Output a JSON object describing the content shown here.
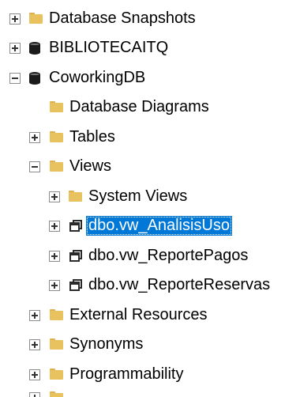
{
  "object_explorer": {
    "nodes": [
      {
        "label": "Database Snapshots",
        "icon": "folder-icon",
        "expander": "plus"
      },
      {
        "label": "BIBLIOTECAITQ",
        "icon": "database-icon",
        "expander": "plus"
      },
      {
        "label": "CoworkingDB",
        "icon": "database-icon",
        "expander": "minus"
      },
      {
        "label": "Database Diagrams",
        "icon": "folder-icon",
        "expander": "none"
      },
      {
        "label": "Tables",
        "icon": "folder-icon",
        "expander": "plus"
      },
      {
        "label": "Views",
        "icon": "folder-icon",
        "expander": "minus"
      },
      {
        "label": "System Views",
        "icon": "folder-icon",
        "expander": "plus"
      },
      {
        "label": "dbo.vw_AnalisisUso",
        "icon": "view-icon",
        "expander": "plus",
        "selected": true
      },
      {
        "label": "dbo.vw_ReportePagos",
        "icon": "view-icon",
        "expander": "plus"
      },
      {
        "label": "dbo.vw_ReporteReservas",
        "icon": "view-icon",
        "expander": "plus"
      },
      {
        "label": "External Resources",
        "icon": "folder-icon",
        "expander": "plus"
      },
      {
        "label": "Synonyms",
        "icon": "folder-icon",
        "expander": "plus"
      },
      {
        "label": "Programmability",
        "icon": "folder-icon",
        "expander": "plus"
      }
    ]
  },
  "colors": {
    "selection": "#0078d7",
    "folder": "#e8c25e",
    "text": "#000000"
  }
}
